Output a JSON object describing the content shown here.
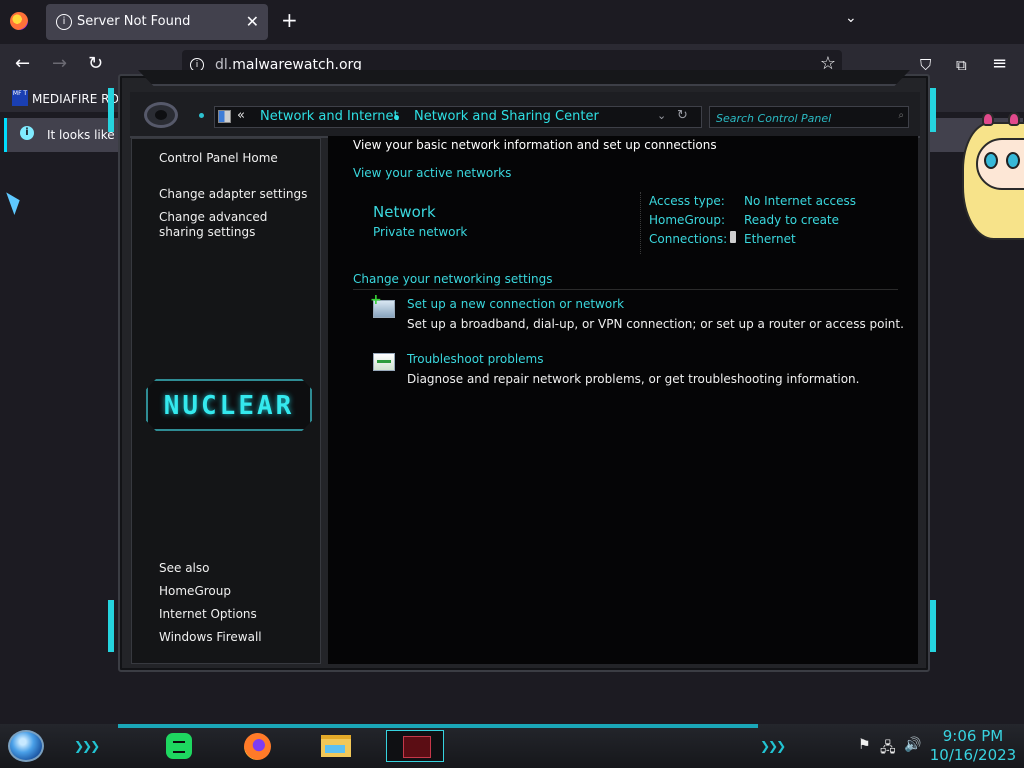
{
  "browser": {
    "tab": {
      "title": "Server Not Found",
      "info_icon": "i",
      "close": "✕"
    },
    "new_tab": "+",
    "tab_list": "⌄",
    "nav": {
      "back": "←",
      "forward": "→",
      "reload": "↻"
    },
    "url": {
      "prefix": "dl.",
      "domain": "malwarewatch.org"
    },
    "star": "☆",
    "toolbar": {
      "pocket": "⛉",
      "extensions": "⧉",
      "menu": "≡"
    },
    "bookmark": {
      "icon_text": "MF T",
      "label": "MEDIAFIRE RO"
    },
    "notice": "It looks like y"
  },
  "window": {
    "address": {
      "back_chevrons": "«",
      "crumb1": "Network and Internet",
      "crumb2": "Network and Sharing Center",
      "dropdown": "⌄",
      "refresh": "↻"
    },
    "search_placeholder": "Search Control Panel",
    "search_icon": "⌕",
    "nav": {
      "home": "Control Panel Home",
      "items": [
        "Change adapter settings",
        "Change advanced sharing settings"
      ],
      "see_also_title": "See also",
      "see_also": [
        "HomeGroup",
        "Internet Options",
        "Windows Firewall"
      ],
      "banner": "NUCLEAR"
    },
    "main": {
      "intro": "View your basic network information and set up connections",
      "active_heading": "View your active networks",
      "network_name": "Network",
      "network_type": "Private network",
      "props": [
        {
          "label": "Access type:",
          "value": "No Internet access"
        },
        {
          "label": "HomeGroup:",
          "value": "Ready to create"
        },
        {
          "label": "Connections:",
          "value": "Ethernet"
        }
      ],
      "settings_heading": "Change your networking settings",
      "tasks": [
        {
          "link": "Set up a new connection or network",
          "desc": "Set up a broadband, dial-up, or VPN connection; or set up a router or access point."
        },
        {
          "link": "Troubleshoot problems",
          "desc": "Diagnose and repair network problems, or get troubleshooting information."
        }
      ]
    }
  },
  "taskbar": {
    "chevrons": "❯❯❯",
    "tray": {
      "flag": "⚑",
      "network": "🖧",
      "volume": "🔊"
    },
    "time": "9:06 PM",
    "date": "10/16/2023"
  },
  "colors": {
    "accent": "#3ad7dd",
    "brand_cyan": "#25d4df"
  }
}
